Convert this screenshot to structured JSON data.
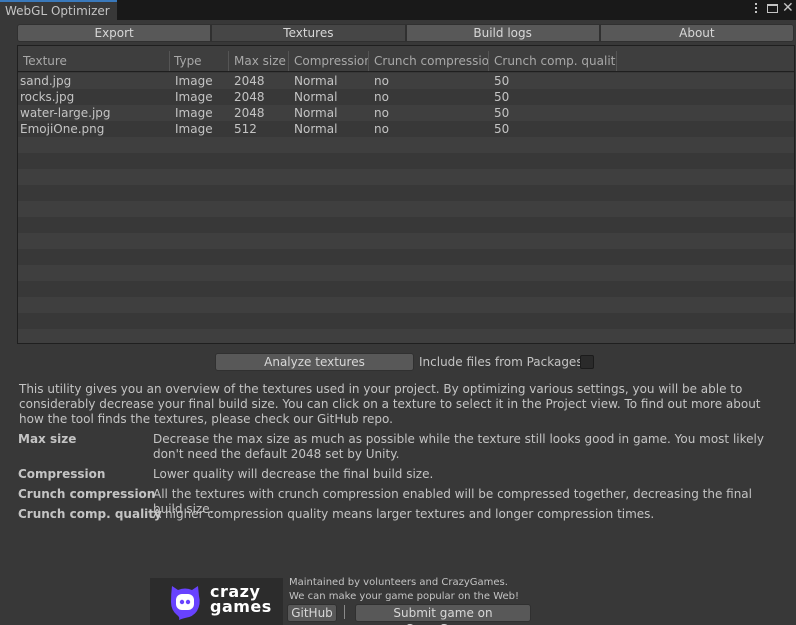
{
  "window": {
    "title": "WebGL Optimizer",
    "menu_icon": "vertical-dots-icon",
    "maximize_icon": "maximize-icon",
    "close_icon": "close-icon",
    "close_glyph": "✕"
  },
  "tabs": [
    {
      "label": "Export",
      "active": false
    },
    {
      "label": "Textures",
      "active": true
    },
    {
      "label": "Build logs",
      "active": false
    },
    {
      "label": "About",
      "active": false
    }
  ],
  "table": {
    "columns": [
      "Texture",
      "Type",
      "Max size",
      "Compression",
      "Crunch compressior",
      "Crunch comp. quality"
    ],
    "rows": [
      [
        "sand.jpg",
        "Image",
        "2048",
        "Normal",
        "no",
        "50"
      ],
      [
        "rocks.jpg",
        "Image",
        "2048",
        "Normal",
        "no",
        "50"
      ],
      [
        "water-large.jpg",
        "Image",
        "2048",
        "Normal",
        "no",
        "50"
      ],
      [
        "EmojiOne.png",
        "Image",
        "512",
        "Normal",
        "no",
        "50"
      ]
    ]
  },
  "actions": {
    "analyze_label": "Analyze textures",
    "include_packages_label": "Include files from Packages",
    "include_packages_checked": false
  },
  "help": {
    "intro": "This utility gives you an overview of the textures used in your project. By optimizing various settings, you will be able to considerably decrease your final build size. You can click on a texture to select it in the Project view. To find out more about how the tool finds the textures, please check our GitHub repo.",
    "items": [
      {
        "key": "Max size",
        "value": "Decrease the max size as much as possible while the texture still looks good in game. You most likely don't need the default 2048 set by Unity."
      },
      {
        "key": "Compression",
        "value": "Lower quality will decrease the final build size."
      },
      {
        "key": "Crunch compression",
        "value": "All the textures with crunch compression enabled will be compressed together, decreasing the final build size."
      },
      {
        "key": "Crunch comp. quality",
        "value": "A higher compression quality means larger textures and longer compression times."
      }
    ]
  },
  "footer": {
    "logo_text_line1": "crazy",
    "logo_text_line2": "games",
    "logo_color": "#6842ff",
    "line1": "Maintained by volunteers and CrazyGames.",
    "line2": "We can make your game popular on the Web!",
    "github_label": "GitHub",
    "submit_label": "Submit game on CrazyGames"
  }
}
